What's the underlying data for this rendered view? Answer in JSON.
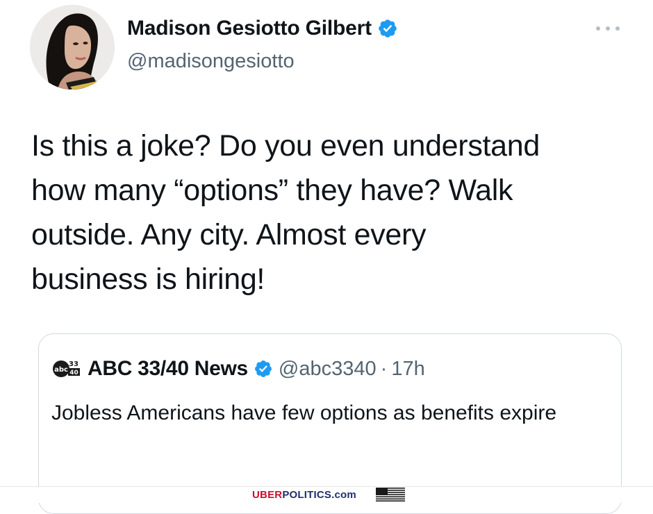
{
  "tweet": {
    "author": {
      "name": "Madison Gesiotto Gilbert",
      "handle": "@madisongesiotto",
      "verified": true
    },
    "text": "Is this a joke? Do you even understand\nhow many “options” they have? Walk\noutside. Any city. Almost every\nbusiness is hiring!",
    "more_icon": "more-horizontal-icon"
  },
  "quote": {
    "logo_icon": "abc-news-logo-icon",
    "name": "ABC 33/40 News",
    "verified": true,
    "handle": "@abc3340",
    "separator": "·",
    "time": "17h",
    "text": "Jobless Americans have few options as benefits expire"
  },
  "watermark": {
    "part1": "UBER",
    "part2": "POLITICS",
    "part3": ".com",
    "flag_icon": "us-flag-icon"
  },
  "colors": {
    "verified_blue": "#1d9bf0",
    "text_primary": "#0f1419",
    "text_secondary": "#536471",
    "border": "#cfd9de",
    "watermark_red": "#c8102e",
    "watermark_navy": "#1f2f6b"
  }
}
